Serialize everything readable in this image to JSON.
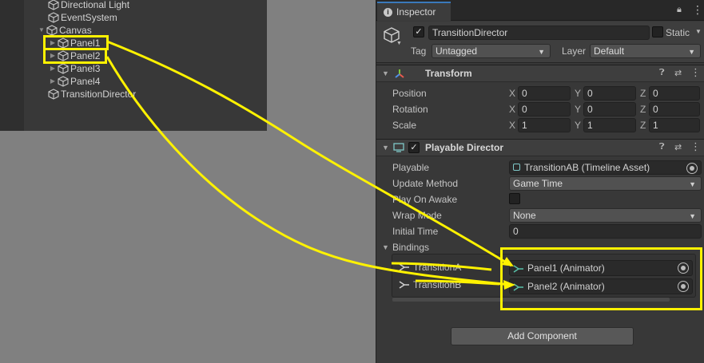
{
  "hierarchy": {
    "items": [
      {
        "label": "Directional Light"
      },
      {
        "label": "EventSystem"
      },
      {
        "label": "Canvas"
      },
      {
        "label": "Panel1"
      },
      {
        "label": "Panel2"
      },
      {
        "label": "Panel3"
      },
      {
        "label": "Panel4"
      },
      {
        "label": "TransitionDirector"
      }
    ]
  },
  "inspector": {
    "tab_label": "Inspector",
    "object": {
      "name": "TransitionDirector",
      "static_label": "Static",
      "tag_label": "Tag",
      "tag_value": "Untagged",
      "layer_label": "Layer",
      "layer_value": "Default"
    },
    "transform": {
      "title": "Transform",
      "rows": [
        {
          "label": "Position",
          "x": "0",
          "y": "0",
          "z": "0"
        },
        {
          "label": "Rotation",
          "x": "0",
          "y": "0",
          "z": "0"
        },
        {
          "label": "Scale",
          "x": "1",
          "y": "1",
          "z": "1"
        }
      ],
      "axis_x": "X",
      "axis_y": "Y",
      "axis_z": "Z"
    },
    "playable_director": {
      "title": "Playable Director",
      "playable_label": "Playable",
      "playable_value": "TransitionAB (Timeline Asset)",
      "update_method_label": "Update Method",
      "update_method_value": "Game Time",
      "play_on_awake_label": "Play On Awake",
      "wrap_mode_label": "Wrap Mode",
      "wrap_mode_value": "None",
      "initial_time_label": "Initial Time",
      "initial_time_value": "0",
      "bindings_label": "Bindings",
      "bindings": [
        {
          "track": "TransitionA",
          "target": "Panel1 (Animator)"
        },
        {
          "track": "TransitionB",
          "target": "Panel2 (Animator)"
        }
      ]
    },
    "add_component_label": "Add Component"
  },
  "colors": {
    "highlight": "#fff200",
    "tab_accent": "#3a79bb"
  }
}
